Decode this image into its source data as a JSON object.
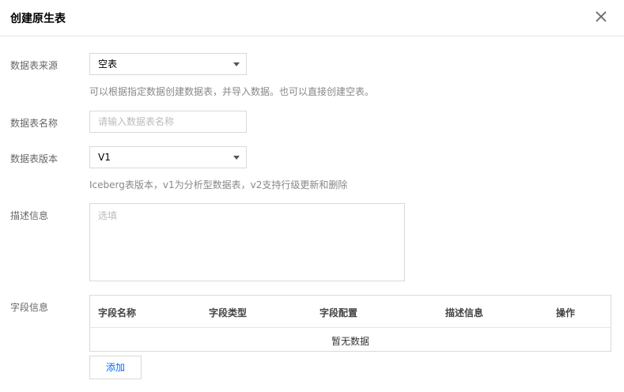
{
  "dialog": {
    "title": "创建原生表",
    "close_icon": "close-icon"
  },
  "form": {
    "source": {
      "label": "数据表来源",
      "value": "空表",
      "hint": "可以根据指定数据创建数据表，并导入数据。也可以直接创建空表。"
    },
    "name": {
      "label": "数据表名称",
      "placeholder": "请输入数据表名称",
      "value": ""
    },
    "version": {
      "label": "数据表版本",
      "value": "V1",
      "hint": "Iceberg表版本，v1为分析型数据表，v2支持行级更新和删除"
    },
    "description": {
      "label": "描述信息",
      "placeholder": "选填",
      "value": ""
    },
    "fields": {
      "label": "字段信息",
      "columns": [
        "字段名称",
        "字段类型",
        "字段配置",
        "描述信息",
        "操作"
      ],
      "empty_text": "暂无数据",
      "add_label": "添加"
    }
  },
  "colors": {
    "accent": "#006eff",
    "border": "#d9d9d9"
  }
}
